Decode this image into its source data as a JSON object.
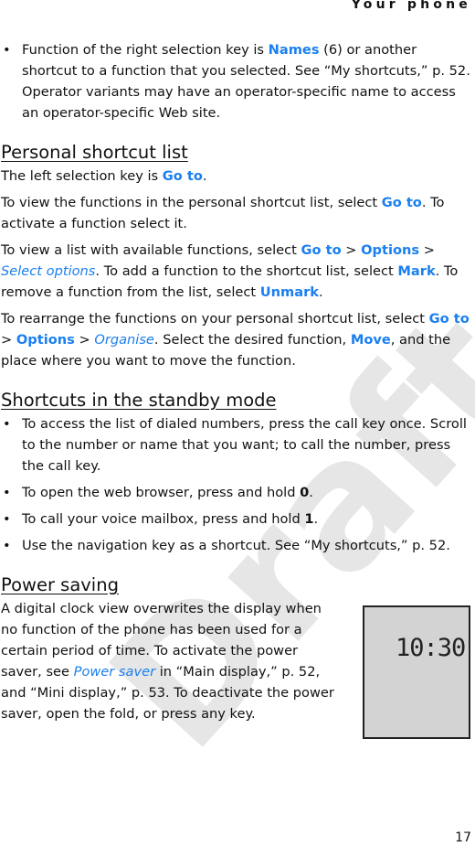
{
  "header": {
    "title": "Your phone",
    "page_number": "17"
  },
  "watermark": "Draft",
  "colors": {
    "link": "#1a7ff0",
    "watermark": "#e6e6e6",
    "display_bg": "#d3d3d3"
  },
  "blocks": [
    {
      "type": "bullet",
      "segs": [
        [
          "Function of the right selection key is ",
          ""
        ],
        [
          "Names",
          "k"
        ],
        [
          " (6) or another shortcut to a function that you selected. See “My shortcuts,” p. 52. Operator variants may have an operator-specific name to access an operator-specific Web site.",
          ""
        ]
      ]
    },
    {
      "type": "heading",
      "text": "Personal shortcut list"
    },
    {
      "type": "para",
      "segs": [
        [
          "The left selection key is ",
          ""
        ],
        [
          "Go to",
          "k"
        ],
        [
          ".",
          ""
        ]
      ]
    },
    {
      "type": "para",
      "segs": [
        [
          "To view the functions in the personal shortcut list, select ",
          ""
        ],
        [
          "Go to",
          "k"
        ],
        [
          ". To activate a function select it.",
          ""
        ]
      ]
    },
    {
      "type": "para",
      "segs": [
        [
          "To view a list with available functions, select ",
          ""
        ],
        [
          "Go to",
          "k"
        ],
        [
          " > ",
          ""
        ],
        [
          "Options",
          "k"
        ],
        [
          " > ",
          ""
        ],
        [
          "Select options",
          "i"
        ],
        [
          ". To add a function to the shortcut list, select ",
          ""
        ],
        [
          "Mark",
          "k"
        ],
        [
          ". To remove a function from the list, select ",
          ""
        ],
        [
          "Unmark",
          "k"
        ],
        [
          ".",
          ""
        ]
      ]
    },
    {
      "type": "para",
      "segs": [
        [
          "To rearrange the functions on your personal shortcut list, select ",
          ""
        ],
        [
          "Go to",
          "k"
        ],
        [
          " > ",
          ""
        ],
        [
          "Options",
          "k"
        ],
        [
          " > ",
          ""
        ],
        [
          "Organise",
          "i"
        ],
        [
          ". Select the desired function, ",
          ""
        ],
        [
          "Move",
          "k"
        ],
        [
          ", and the place where you want to move the function.",
          ""
        ]
      ]
    },
    {
      "type": "heading",
      "text": "Shortcuts in the standby mode"
    },
    {
      "type": "bullet",
      "segs": [
        [
          "To access the list of dialed numbers, press the call key once. Scroll to the number or name that you want; to call the number, press the call key.",
          ""
        ]
      ]
    },
    {
      "type": "bullet",
      "segs": [
        [
          "To open the web browser, press and hold ",
          ""
        ],
        [
          "0",
          "b"
        ],
        [
          ".",
          ""
        ]
      ]
    },
    {
      "type": "bullet",
      "segs": [
        [
          "To call your voice mailbox, press and hold ",
          ""
        ],
        [
          "1",
          "b"
        ],
        [
          ".",
          ""
        ]
      ]
    },
    {
      "type": "bullet",
      "segs": [
        [
          "Use the navigation key as a shortcut. See “My shortcuts,” p. 52.",
          ""
        ]
      ]
    },
    {
      "type": "heading",
      "text": "Power saving"
    },
    {
      "type": "para",
      "narrow": true,
      "segs": [
        [
          "A digital clock view overwrites the display when no function of the phone has been used for a certain period of time. To activate the power saver, see ",
          ""
        ],
        [
          "Power saver",
          "i"
        ],
        [
          " in “Main display,” p. 52, and “Mini display,” p. 53. To deactivate the power saver, open the fold, or press any key.",
          ""
        ]
      ]
    }
  ],
  "clock_display": {
    "time": "10:30"
  }
}
